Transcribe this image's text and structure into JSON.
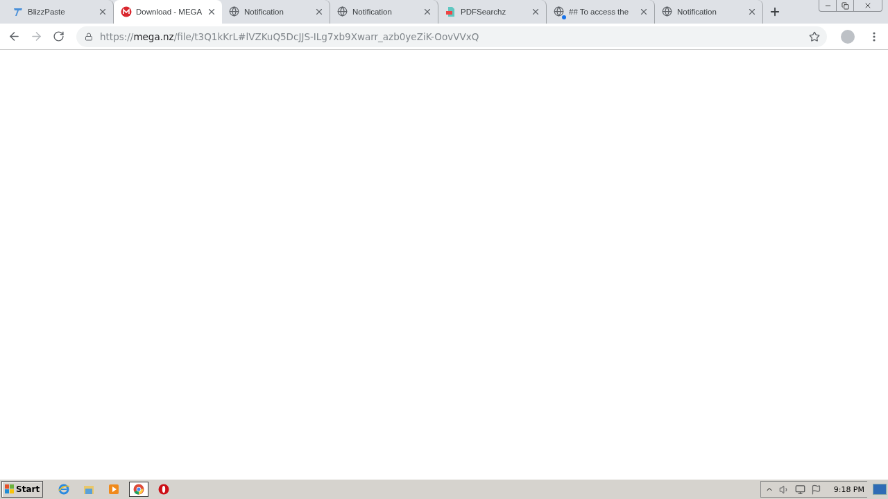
{
  "tabs": [
    {
      "title": "BlizzPaste",
      "kind": "blizz",
      "selected": false,
      "indicator": false
    },
    {
      "title": "Download - MEGA",
      "kind": "mega",
      "selected": true,
      "indicator": false
    },
    {
      "title": "Notification",
      "kind": "globe",
      "selected": false,
      "indicator": false
    },
    {
      "title": "Notification",
      "kind": "globe",
      "selected": false,
      "indicator": false
    },
    {
      "title": "PDFSearchz",
      "kind": "pdf",
      "selected": false,
      "indicator": false
    },
    {
      "title": "## To access the",
      "kind": "globe",
      "selected": false,
      "indicator": true
    },
    {
      "title": "Notification",
      "kind": "globe",
      "selected": false,
      "indicator": false
    }
  ],
  "address_bar": {
    "scheme": "https://",
    "host": "mega.nz",
    "path": "/file/t3Q1kKrL#lVZKuQ5DcJJS-ILg7xb9Xwarr_azb0yeZiK-OovVVxQ"
  },
  "taskbar": {
    "start": "Start",
    "apps": [
      {
        "kind": "ie",
        "selected": false
      },
      {
        "kind": "explorer",
        "selected": false
      },
      {
        "kind": "media",
        "selected": false
      },
      {
        "kind": "chrome",
        "selected": true
      },
      {
        "kind": "opera",
        "selected": false
      }
    ],
    "clock": "9:18 PM"
  }
}
